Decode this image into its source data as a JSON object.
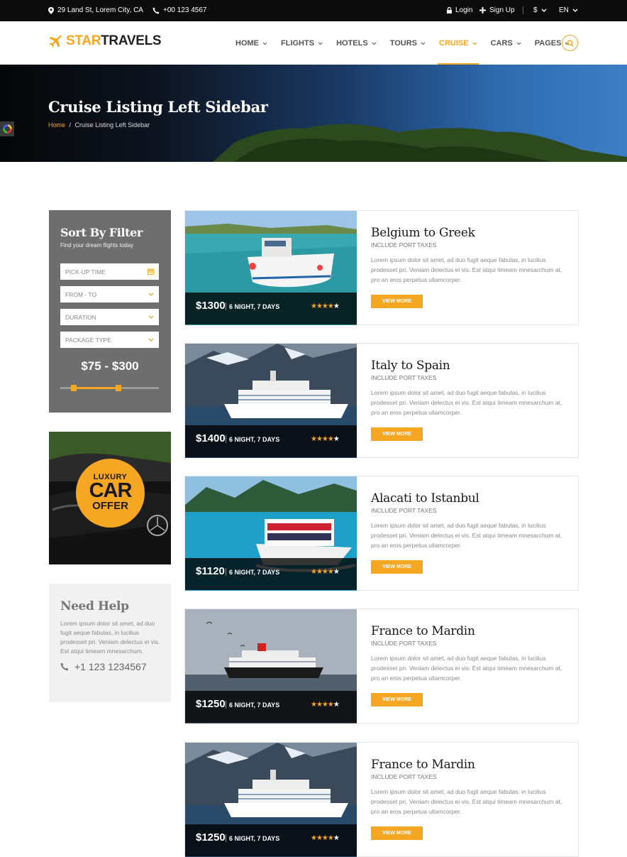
{
  "topbar": {
    "address": "29 Land St, Lorem City, CA",
    "phone": "+00 123 4567",
    "login": "Login",
    "signup": "Sign Up",
    "currency": "$",
    "language": "EN"
  },
  "logo": {
    "part1": "STAR",
    "part2": "TRAVELS"
  },
  "nav": {
    "items": [
      {
        "label": "HOME"
      },
      {
        "label": "FLIGHTS"
      },
      {
        "label": "HOTELS"
      },
      {
        "label": "TOURS"
      },
      {
        "label": "CRUISE"
      },
      {
        "label": "CARS"
      },
      {
        "label": "PAGES"
      }
    ],
    "active": "CRUISE"
  },
  "hero": {
    "title": "Cruise Listing Left Sidebar",
    "breadcrumb_home": "Home",
    "breadcrumb_sep": "/",
    "breadcrumb_current": "Cruise Listing Left Sidebar"
  },
  "filter": {
    "title": "Sort By Filter",
    "subtitle": "Find your dream flights today",
    "fields": [
      "PICK-UP TIME",
      "FROM - TO",
      "DURATION",
      "PACKAGE TYPE"
    ],
    "price_range": "$75 - $300"
  },
  "car_offer": {
    "line1": "LUXURY",
    "line2": "CAR",
    "line3": "OFFER"
  },
  "help": {
    "title": "Need Help",
    "text": "Lorem ipsum dolor sit amet, ad duo fugit aeque fabulas, in lucilius prodesset pri. Veniam delectus ei vis. Est atqui timeam mnesarchum.",
    "phone": "+1 123 1234567"
  },
  "cruises": [
    {
      "title": "Belgium to Greek",
      "taxes": "INCLUDE PORT TAXES",
      "desc": "Lorem ipsum dolor sit amet, ad duo fugit aeque fabulas, in lucilius prodesset pri. Veniam delectus ei vis. Est atqui timeam mnesarchum at, pro an eros perpetua ullamcorper.",
      "price": "$1300",
      "duration": "6 NIGHT, 7 DAYS",
      "rating": 4,
      "button": "VIEW MORE"
    },
    {
      "title": "Italy to Spain",
      "taxes": "INCLUDE PORT TAXES",
      "desc": "Lorem ipsum dolor sit amet, ad duo fugit aeque fabulas, in lucilius prodesset pri. Veniam delectus ei vis. Est atqui timeam mnesarchum at, pro an eros perpetua ullamcorper.",
      "price": "$1400",
      "duration": "6 NIGHT, 7 DAYS",
      "rating": 4,
      "button": "VIEW MORE"
    },
    {
      "title": "Alacati to Istanbul",
      "taxes": "INCLUDE PORT TAXES",
      "desc": "Lorem ipsum dolor sit amet, ad duo fugit aeque fabulas, in lucilius prodesset pri. Veniam delectus ei vis. Est atqui timeam mnesarchum at, pro an eros perpetua ullamcorper.",
      "price": "$1120",
      "duration": "6 NIGHT, 7 DAYS",
      "rating": 4,
      "button": "VIEW MORE"
    },
    {
      "title": "France to Mardin",
      "taxes": "INCLUDE PORT TAXES",
      "desc": "Lorem ipsum dolor sit amet, ad duo fugit aeque fabulas, in lucilius prodesset pri. Veniam delectus ei vis. Est atqui timeam mnesarchum at, pro an eros perpetua ullamcorper.",
      "price": "$1250",
      "duration": "6 NIGHT, 7 DAYS",
      "rating": 4,
      "button": "VIEW MORE"
    },
    {
      "title": "France to Mardin",
      "taxes": "INCLUDE PORT TAXES",
      "desc": "Lorem ipsum dolor sit amet, ad duo fugit aeque fabulas, in lucilius prodesset pri. Veniam delectus ei vis. Est atqui timeam mnesarchum at, pro an eros perpetua ullamcorper.",
      "price": "$1250",
      "duration": "6 NIGHT, 7 DAYS",
      "rating": 4,
      "button": "VIEW MORE"
    }
  ],
  "colors": {
    "accent": "#f5a623",
    "topbar": "#0c0c0c",
    "filter_bg": "#6e6e6e",
    "help_bg": "#f1f1f1"
  }
}
